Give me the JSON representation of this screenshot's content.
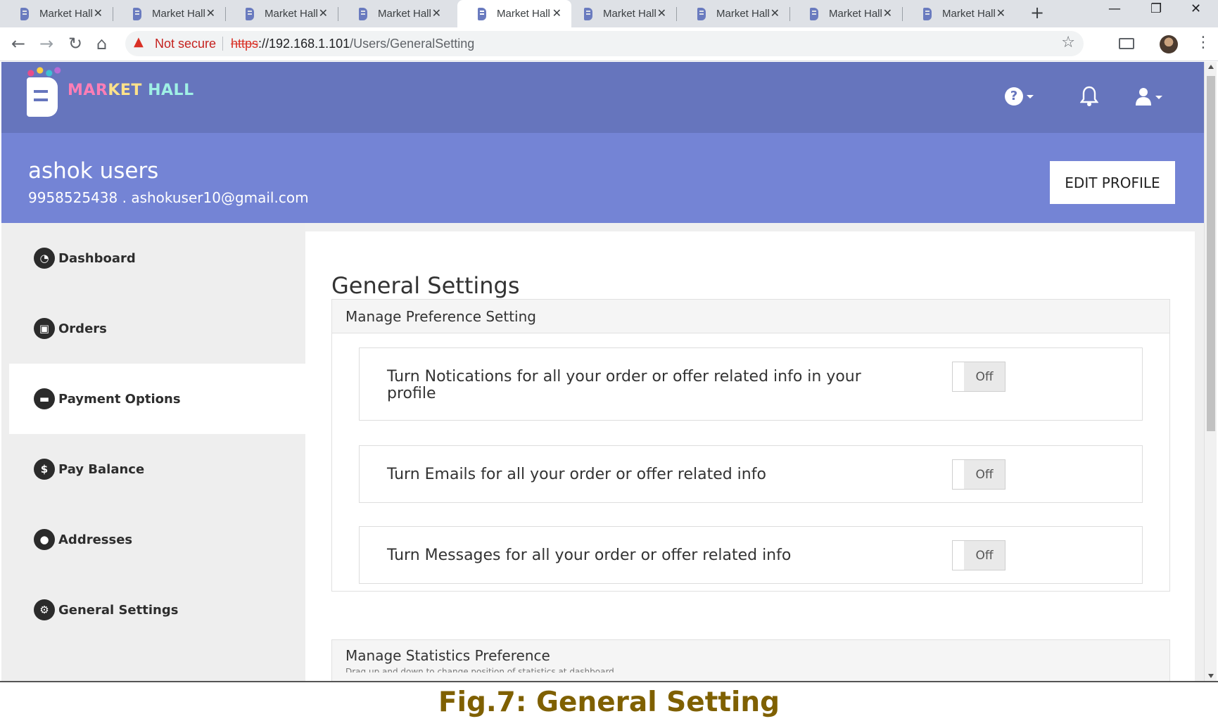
{
  "browser": {
    "tabs": [
      {
        "title": "Market Hall",
        "active": false
      },
      {
        "title": "Market Hall",
        "active": false
      },
      {
        "title": "Market Hall",
        "active": false
      },
      {
        "title": "Market Hall",
        "active": false
      },
      {
        "title": "Market Hall",
        "active": true
      },
      {
        "title": "Market Hall",
        "active": false
      },
      {
        "title": "Market Hall",
        "active": false
      },
      {
        "title": "Market Hall",
        "active": false
      },
      {
        "title": "Market Hall",
        "active": false
      }
    ],
    "tab_close_glyph": "✕",
    "new_tab_glyph": "+",
    "security_label": "Not secure",
    "url_scheme": "https",
    "url_host": "://192.168.1.101",
    "url_path": "/Users/GeneralSetting",
    "icons": [
      "back-icon",
      "forward-icon",
      "reload-icon",
      "home-icon",
      "warning-icon",
      "star-icon",
      "cast-icon",
      "profile-avatar",
      "menu-icon",
      "minimize-icon",
      "restore-icon",
      "close-window-icon"
    ]
  },
  "site": {
    "logo_text_parts": [
      "MAR",
      "KET ",
      "HALL"
    ],
    "colors": {
      "navbar": "#6675bd",
      "profile_band": "#7484d5",
      "caption": "#7f6000"
    }
  },
  "profile": {
    "name": "ashok users",
    "contact": "9958525438 . ashokuser10@gmail.com",
    "edit_label": "EDIT PROFILE"
  },
  "sidebar": {
    "items": [
      {
        "label": "Dashboard",
        "icon": "dashboard-icon",
        "glyph": "◔",
        "active": false
      },
      {
        "label": "Orders",
        "icon": "shopping-bag-icon",
        "glyph": "▣",
        "active": false
      },
      {
        "label": "Payment Options",
        "icon": "credit-card-icon",
        "glyph": "▬",
        "active": true
      },
      {
        "label": "Pay Balance",
        "icon": "dollar-icon",
        "glyph": "$",
        "active": false
      },
      {
        "label": "Addresses",
        "icon": "map-pin-icon",
        "glyph": "●",
        "active": false
      },
      {
        "label": "General Settings",
        "icon": "gear-icon",
        "glyph": "⚙",
        "active": false
      }
    ]
  },
  "main": {
    "title": "General Settings",
    "preference_panel": {
      "heading": "Manage Preference Setting",
      "rows": [
        {
          "text": "Turn Notications for all your order or offer related info in your profile",
          "state": "Off"
        },
        {
          "text": "Turn Emails for all your order or offer related info",
          "state": "Off"
        },
        {
          "text": "Turn Messages for all your order or offer related info",
          "state": "Off"
        }
      ]
    },
    "statistics_panel": {
      "heading": "Manage Statistics Preference",
      "subtext": "Drag up and down to change position of statistics at dashboard"
    }
  },
  "caption": "Fig.7: General Setting"
}
